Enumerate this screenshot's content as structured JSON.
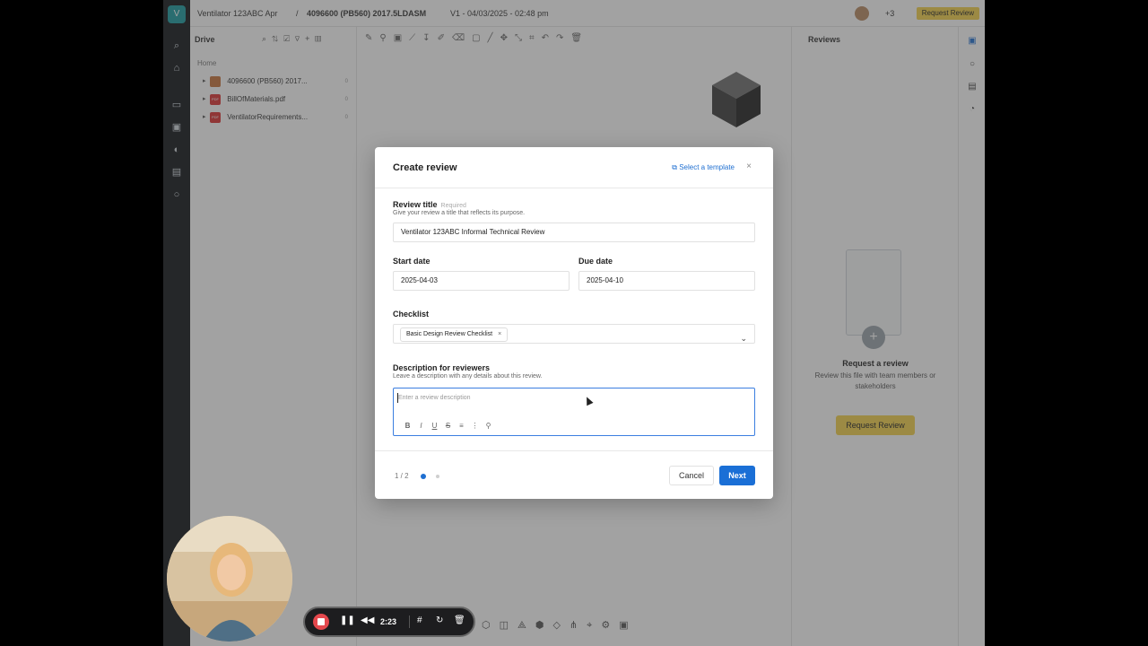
{
  "app": {
    "logo": "V",
    "breadcrumb_project": "Ventilator 123ABC Apr",
    "breadcrumb_sep": "/",
    "file_name": "4096600 (PB560) 2017.5LDASM",
    "version": "V1 - 04/03/2025 - 02:48 pm",
    "users_count": "+3",
    "request_review_top": "Request Review"
  },
  "drive": {
    "title": "Drive",
    "home": "Home",
    "files": [
      {
        "name": "4096600 (PB560) 2017...",
        "type": "assembly",
        "count": "0"
      },
      {
        "name": "BillOfMaterials.pdf",
        "type": "pdf",
        "count": "0"
      },
      {
        "name": "VentilatorRequirements...",
        "type": "pdf",
        "count": "0"
      }
    ]
  },
  "reviews_panel": {
    "title": "Reviews",
    "empty_heading": "Request a review",
    "empty_text": "Review this file with team members or stakeholders",
    "button": "Request Review"
  },
  "modal": {
    "title": "Create review",
    "select_template": "Select a template",
    "close": "×",
    "review_title_label": "Review title",
    "required_tag": "Required",
    "review_title_hint": "Give your review a title that reflects its purpose.",
    "review_title_value": "Ventilator 123ABC Informal Technical Review",
    "start_date_label": "Start date",
    "start_date_value": "2025-04-03",
    "due_date_label": "Due date",
    "due_date_value": "2025-04-10",
    "checklist_label": "Checklist",
    "checklist_chip": "Basic Design Review Checklist",
    "chip_remove": "×",
    "description_label": "Description for reviewers",
    "description_hint": "Leave a description with any details about this review.",
    "description_placeholder": "Enter a review description",
    "format_tools": [
      "B",
      "I",
      "U",
      "S",
      "≡",
      "⋮",
      "⚲"
    ],
    "page_indicator": "1 / 2",
    "cancel": "Cancel",
    "next": "Next"
  },
  "recorder": {
    "time": "2:23"
  },
  "colors": {
    "accent_blue": "#1a6fd6",
    "accent_yellow": "#f3d24b",
    "record_red": "#e5484d"
  }
}
